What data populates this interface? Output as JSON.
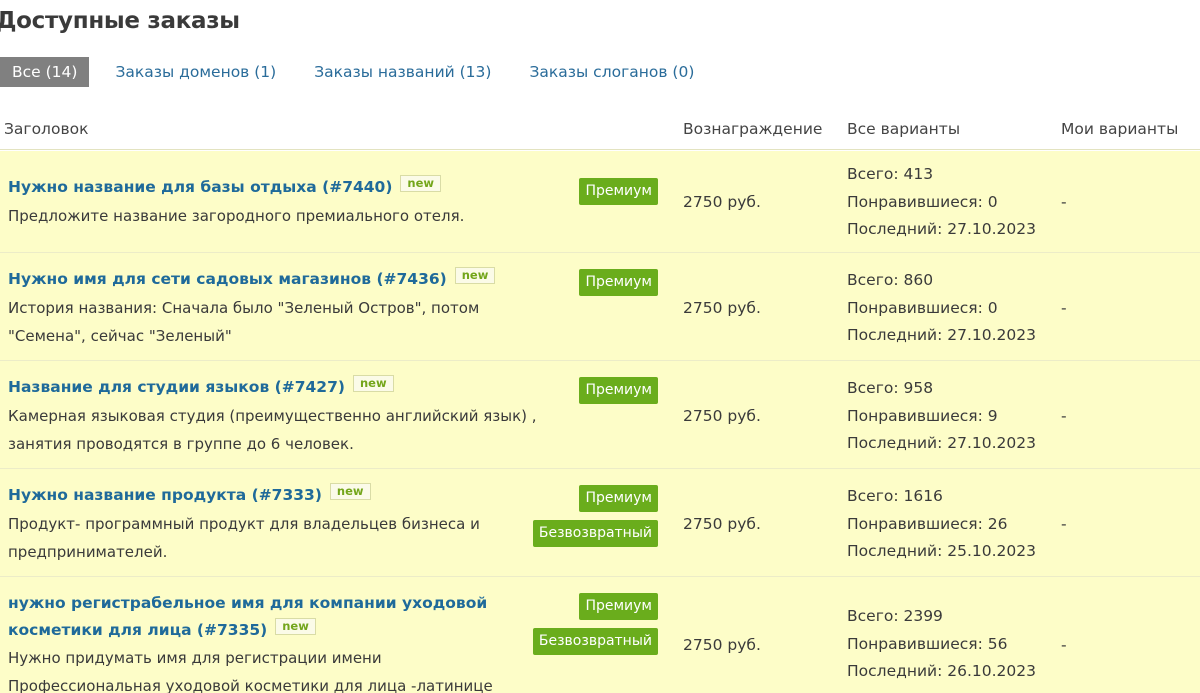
{
  "page": {
    "title": "Доступные заказы"
  },
  "tabs": [
    {
      "label": "Все (14)",
      "active": true
    },
    {
      "label": "Заказы доменов (1)",
      "active": false
    },
    {
      "label": "Заказы названий (13)",
      "active": false
    },
    {
      "label": "Заказы слоганов (0)",
      "active": false
    }
  ],
  "columns": {
    "title": "Заголовок",
    "reward": "Вознаграждение",
    "all_variants": "Все варианты",
    "my_variants": "Мои варианты"
  },
  "orders": [
    {
      "title": "Нужно название для базы отдыха (#7440)",
      "new_label": "new",
      "description": "Предложите название загородного премиального отеля.",
      "badges": [
        "Премиум"
      ],
      "reward": "2750 руб.",
      "total": "Всего: 413",
      "liked": "Понравившиеся: 0",
      "last": "Последний: 27.10.2023",
      "mine": "-"
    },
    {
      "title": "Нужно имя для сети садовых магазинов (#7436)",
      "new_label": "new",
      "description": "История названия: Сначала было \"Зеленый Остров\", потом \"Семена\", сейчас \"Зеленый\"",
      "badges": [
        "Премиум"
      ],
      "reward": "2750 руб.",
      "total": "Всего: 860",
      "liked": "Понравившиеся: 0",
      "last": "Последний: 27.10.2023",
      "mine": "-"
    },
    {
      "title": "Название для студии языков (#7427)",
      "new_label": "new",
      "description": "Камерная языковая студия (преимущественно английский язык) , занятия проводятся в группе до 6 человек.",
      "badges": [
        "Премиум"
      ],
      "reward": "2750 руб.",
      "total": "Всего: 958",
      "liked": "Понравившиеся: 9",
      "last": "Последний: 27.10.2023",
      "mine": "-"
    },
    {
      "title": "Нужно название продукта (#7333)",
      "new_label": "new",
      "description": "Продукт- программный продукт для владельцев бизнеса и предпринимателей.",
      "badges": [
        "Премиум",
        "Безвозвратный"
      ],
      "reward": "2750 руб.",
      "total": "Всего: 1616",
      "liked": "Понравившиеся: 26",
      "last": "Последний: 25.10.2023",
      "mine": "-"
    },
    {
      "title": "нужно регистрабельное имя для компании уходовой косметики для лица (#7335)",
      "new_label": "new",
      "description": "Нужно придумать имя для регистрации имени Профессиональная уходовой косметики для лица -латинице",
      "badges": [
        "Премиум",
        "Безвозвратный"
      ],
      "reward": "2750 руб.",
      "total": "Всего: 2399",
      "liked": "Понравившиеся: 56",
      "last": "Последний: 26.10.2023",
      "mine": "-"
    }
  ]
}
